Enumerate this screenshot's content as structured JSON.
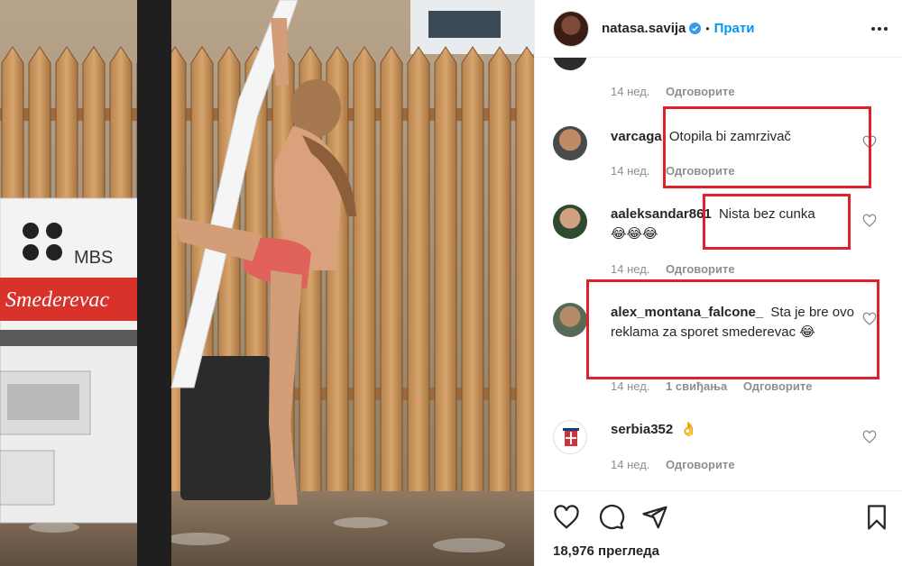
{
  "post": {
    "username": "natasa.savija",
    "separator": "•",
    "follow_label": "Прати",
    "verified_icon": "verified-badge-icon",
    "media_watermark": {
      "brand": "MBS",
      "sign": "Smederevac"
    }
  },
  "comments": [
    {
      "username": "",
      "text": "",
      "time": "14 нед.",
      "likes": "",
      "reply": "Одговорите"
    },
    {
      "username": "varcaga",
      "text": "Otopila bi zamrzivač",
      "time": "14 нед.",
      "likes": "",
      "reply": "Одговорите"
    },
    {
      "username": "aaleksandar861",
      "text": "Nista bez cunka",
      "emoji": "😂😂😂",
      "time": "14 нед.",
      "likes": "",
      "reply": "Одговорите"
    },
    {
      "username": "alex_montana_falcone_",
      "text": "Sta je bre ovo reklama za sporet smederevac 😂",
      "time": "14 нед.",
      "likes": "1 свиђања",
      "reply": "Одговорите"
    },
    {
      "username": "serbia352",
      "text": "👌",
      "time": "14 нед.",
      "likes": "",
      "reply": "Одговорите"
    }
  ],
  "footer": {
    "views": "18,976 прегледа"
  },
  "colors": {
    "accent": "#0095f6",
    "highlight": "#e0202a",
    "muted": "#8e8e8e"
  }
}
